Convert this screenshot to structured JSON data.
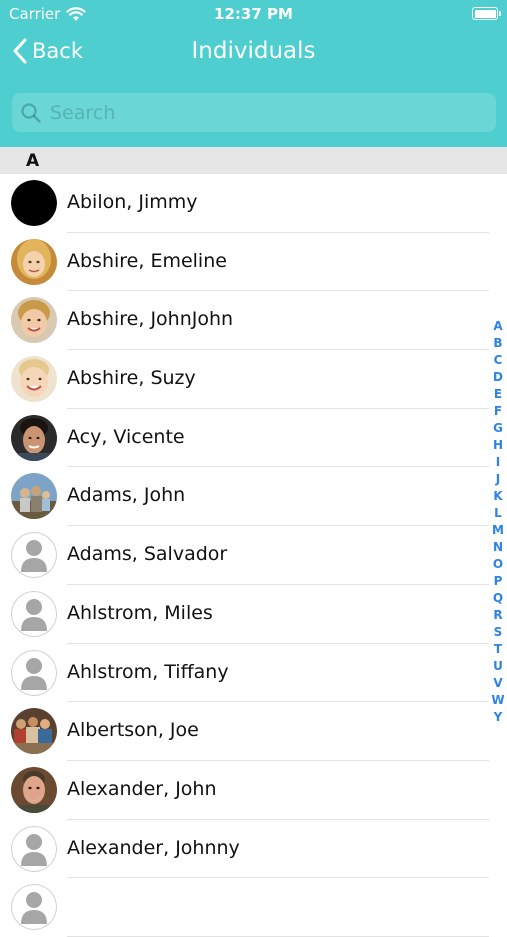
{
  "status_bar": {
    "carrier": "Carrier",
    "time": "12:37 PM",
    "battery_level": 1.0
  },
  "nav": {
    "back_label": "Back",
    "title": "Individuals"
  },
  "search": {
    "placeholder": "Search",
    "value": ""
  },
  "section": {
    "letter": "A"
  },
  "contacts": [
    {
      "name": "Abilon, Jimmy",
      "avatar": "black-circle"
    },
    {
      "name": "Abshire, Emeline",
      "avatar": "photo-blonde-woman"
    },
    {
      "name": "Abshire, JohnJohn",
      "avatar": "photo-child"
    },
    {
      "name": "Abshire, Suzy",
      "avatar": "photo-child-smiling"
    },
    {
      "name": "Acy, Vicente",
      "avatar": "photo-man-dark-hair"
    },
    {
      "name": "Adams, John",
      "avatar": "photo-family-outdoors"
    },
    {
      "name": "Adams, Salvador",
      "avatar": "placeholder-person"
    },
    {
      "name": "Ahlstrom, Miles",
      "avatar": "placeholder-person"
    },
    {
      "name": "Ahlstrom, Tiffany",
      "avatar": "placeholder-person"
    },
    {
      "name": "Albertson, Joe",
      "avatar": "photo-group"
    },
    {
      "name": "Alexander, John",
      "avatar": "photo-bearded-man"
    },
    {
      "name": "Alexander, Johnny",
      "avatar": "placeholder-person"
    },
    {
      "name": "",
      "avatar": "placeholder-person"
    }
  ],
  "index_letters": [
    "A",
    "B",
    "C",
    "D",
    "E",
    "F",
    "G",
    "H",
    "I",
    "J",
    "K",
    "L",
    "M",
    "N",
    "O",
    "P",
    "Q",
    "R",
    "S",
    "T",
    "U",
    "V",
    "W",
    "Y"
  ],
  "colors": {
    "header": "#4ecece",
    "index_accent": "#2d84e6",
    "section_bg": "#e6e6e6"
  }
}
